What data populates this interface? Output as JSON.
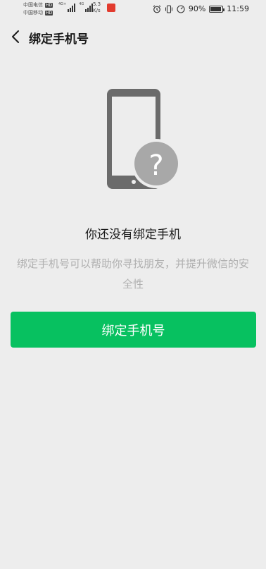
{
  "status_bar": {
    "carrier_1": "中国电信",
    "carrier_2": "中国移动",
    "hd_badge": "HD",
    "network_1": "4G+",
    "network_2": "4G",
    "speed_value": "5.3",
    "speed_unit": "K/s",
    "battery_percent": "90%",
    "battery_level": 0.9,
    "time": "11:59"
  },
  "nav": {
    "back_icon": "chevron-left-icon",
    "title": "绑定手机号"
  },
  "illustration": {
    "icon": "phone-question-icon",
    "question_mark": "?"
  },
  "content": {
    "headline": "你还没有绑定手机",
    "description": "绑定手机号可以帮助你寻找朋友，并提升微信的安全性"
  },
  "actions": {
    "bind_label": "绑定手机号"
  },
  "colors": {
    "accent": "#07c160",
    "background": "#ededed",
    "phone": "#6b6b6b",
    "badge": "#a8a8a8"
  }
}
